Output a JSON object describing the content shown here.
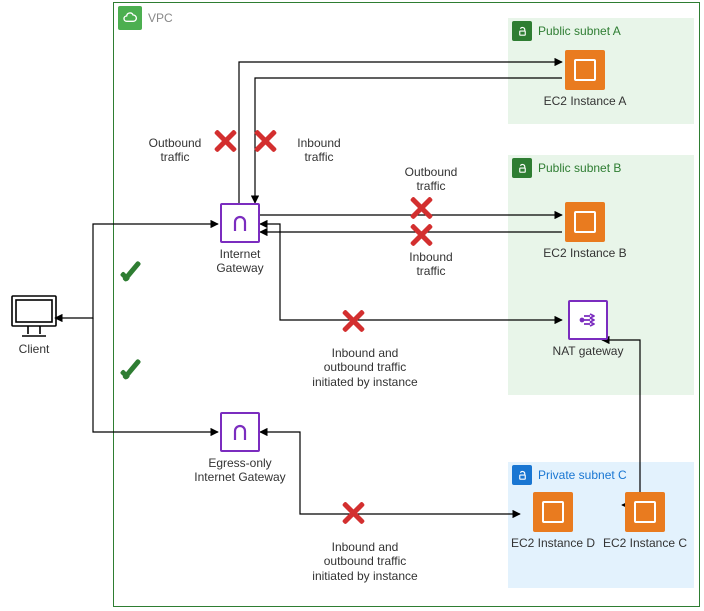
{
  "container": {
    "label": "VPC"
  },
  "subnets": {
    "A": {
      "label": "Public subnet A"
    },
    "B": {
      "label": "Public subnet B"
    },
    "C": {
      "label": "Private subnet C"
    }
  },
  "nodes": {
    "client": {
      "label": "Client"
    },
    "igw": {
      "label": "Internet Gateway"
    },
    "eigw": {
      "label": "Egress-only\nInternet Gateway"
    },
    "ec2A": {
      "label": "EC2 Instance A"
    },
    "ec2B": {
      "label": "EC2 Instance B"
    },
    "nat": {
      "label": "NAT gateway"
    },
    "ec2C": {
      "label": "EC2 Instance C"
    },
    "ec2D": {
      "label": "EC2 Instance D"
    }
  },
  "labels": {
    "outbound": "Outbound\ntraffic",
    "inbound": "Inbound\ntraffic",
    "outbound2": "Outbound\ntraffic",
    "inbound2": "Inbound\ntraffic",
    "bidir1": "Inbound and\noutbound traffic\ninitiated by instance",
    "bidir2": "Inbound and\noutbound traffic\ninitiated by instance"
  },
  "flows": [
    {
      "from": "client",
      "to": "igw",
      "allowed": true
    },
    {
      "from": "client",
      "to": "eigw",
      "allowed": true
    },
    {
      "from": "ec2A",
      "to": "igw",
      "direction": "outbound",
      "allowed": false
    },
    {
      "from": "igw",
      "to": "ec2A",
      "direction": "inbound",
      "allowed": false
    },
    {
      "from": "ec2B",
      "to": "igw",
      "direction": "outbound",
      "allowed": false
    },
    {
      "from": "igw",
      "to": "ec2B",
      "direction": "inbound",
      "allowed": false
    },
    {
      "from": "nat",
      "to": "igw",
      "direction": "both",
      "allowed": false
    },
    {
      "from": "ec2D",
      "to": "eigw",
      "direction": "both",
      "allowed": false
    },
    {
      "from": "ec2C",
      "to": "nat",
      "allowed": true
    }
  ]
}
